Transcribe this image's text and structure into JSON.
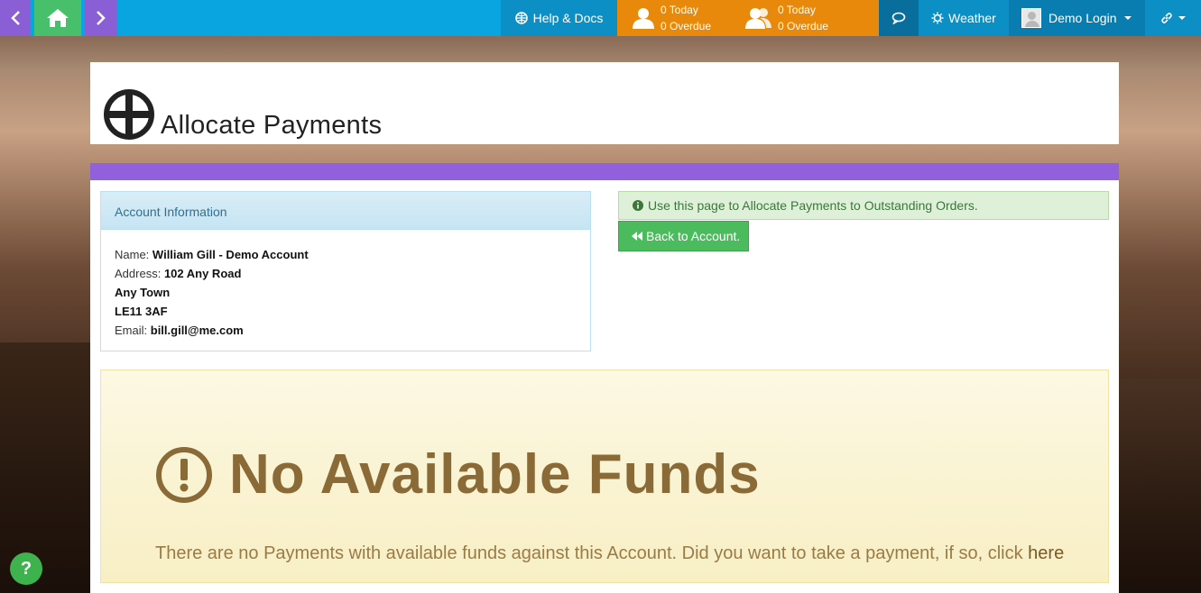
{
  "nav": {
    "back_icon": "chevron-left-icon",
    "home_icon": "home-icon",
    "forward_icon": "chevron-right-icon"
  },
  "topbar": {
    "help_label": "Help & Docs",
    "tasks_personal": {
      "today": "0 Today",
      "overdue": "0 Overdue"
    },
    "tasks_team": {
      "today": "0 Today",
      "overdue": "0 Overdue"
    },
    "weather_label": "Weather",
    "user_label": "Demo Login"
  },
  "page": {
    "title": "Allocate Payments"
  },
  "account": {
    "heading": "Account Information",
    "name_label": "Name:",
    "name": "William Gill - Demo Account",
    "address_label": "Address:",
    "address_line1": "102 Any Road",
    "address_line2": "Any Town",
    "address_line3": "LE11 3AF",
    "email_label": "Email:",
    "email": "bill.gill@me.com"
  },
  "info": {
    "message": "Use this page to Allocate Payments to Outstanding Orders.",
    "back_button": "Back to Account."
  },
  "warning": {
    "title": "No Available Funds",
    "text": "There are no Payments with available funds against this Account. Did you want to take a payment, if so, click ",
    "link": "here"
  },
  "colors": {
    "topbar": "#08a5e0",
    "nav_purple": "#8a5fd6",
    "home_green": "#48bf6a",
    "tasks_orange": "#e8890c",
    "strip_purple": "#9160dd",
    "button_green": "#4cbb5e"
  }
}
